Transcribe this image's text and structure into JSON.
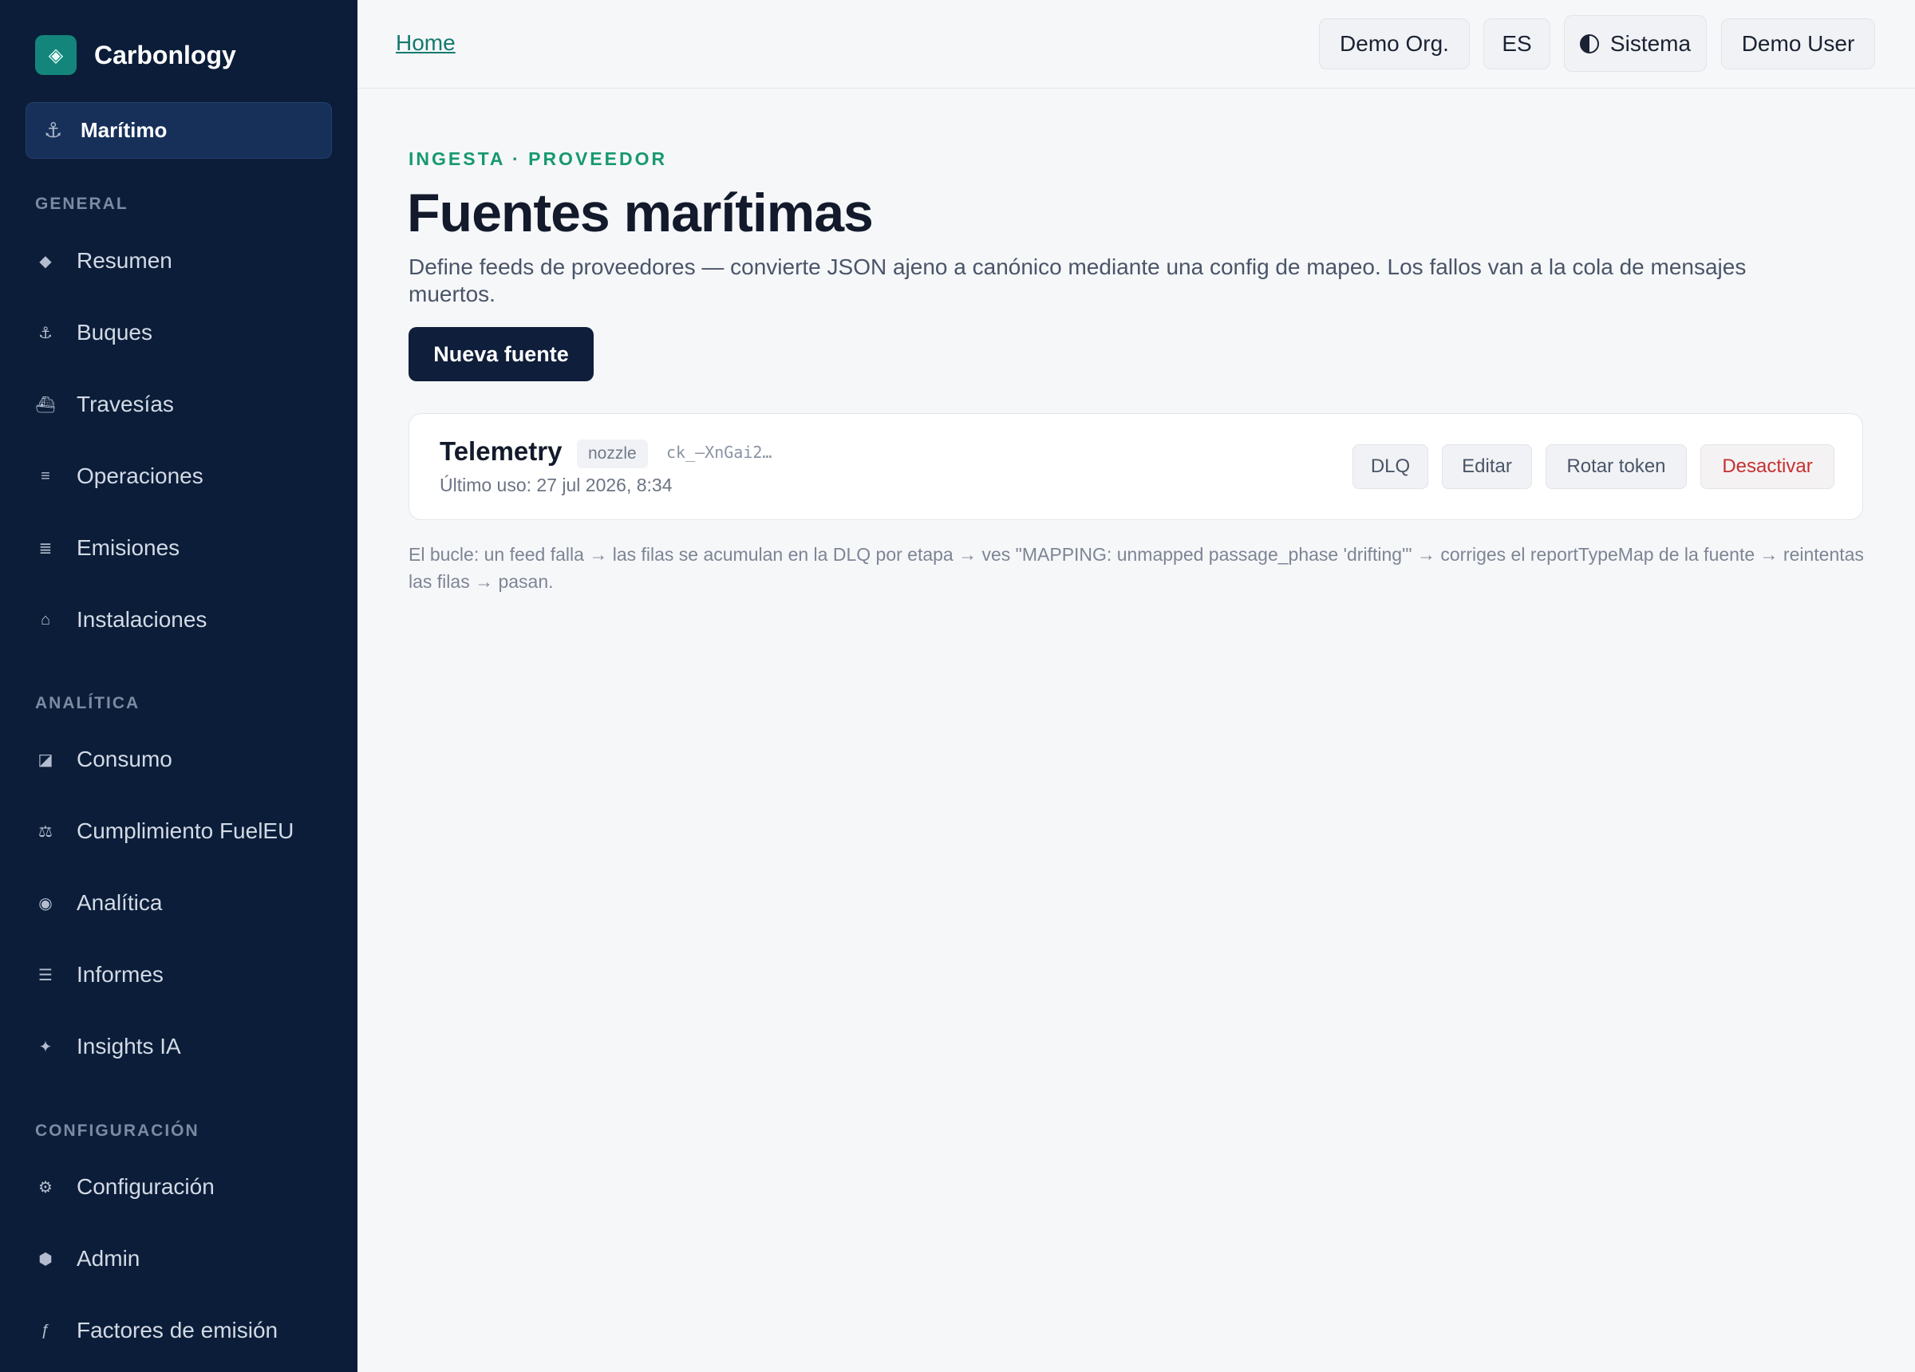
{
  "app": {
    "name": "Carbonlogy"
  },
  "module": {
    "label": "Marítimo"
  },
  "sidebar": {
    "sections": [
      {
        "title": "GENERAL",
        "items": [
          {
            "label": "Resumen",
            "icon": "diamond-icon"
          },
          {
            "label": "Buques",
            "icon": "anchor-icon"
          },
          {
            "label": "Travesías",
            "icon": "ship-icon"
          },
          {
            "label": "Operaciones",
            "icon": "list-icon"
          },
          {
            "label": "Emisiones",
            "icon": "bars-icon"
          },
          {
            "label": "Instalaciones",
            "icon": "home-icon"
          }
        ]
      },
      {
        "title": "ANALÍTICA",
        "items": [
          {
            "label": "Consumo",
            "icon": "gauge-icon"
          },
          {
            "label": "Cumplimiento FuelEU",
            "icon": "scale-icon"
          },
          {
            "label": "Analítica",
            "icon": "target-icon"
          },
          {
            "label": "Informes",
            "icon": "report-icon"
          },
          {
            "label": "Insights IA",
            "icon": "sparkle-icon"
          }
        ]
      },
      {
        "title": "CONFIGURACIÓN",
        "items": [
          {
            "label": "Configuración",
            "icon": "gear-icon"
          },
          {
            "label": "Admin",
            "icon": "hexagon-icon"
          },
          {
            "label": "Factores de emisión",
            "icon": "function-icon"
          }
        ]
      }
    ]
  },
  "header": {
    "breadcrumb": "Home",
    "org": "Demo Org.",
    "lang": "ES",
    "theme": "Sistema",
    "user": "Demo User"
  },
  "main": {
    "kicker": "INGESTA · PROVEEDOR",
    "title": "Fuentes marítimas",
    "description": "Define feeds de proveedores — convierte JSON ajeno a canónico mediante una config de mapeo. Los fallos van a la cola de mensajes muertos.",
    "new_button": "Nueva fuente",
    "sources": [
      {
        "name": "Telemetry",
        "type": "nozzle",
        "token": "ck_–XnGai2…",
        "last_used": "Último uso: 27 jul 2026, 8:34",
        "actions": {
          "dlq": "DLQ",
          "edit": "Editar",
          "rotate": "Rotar token",
          "deactivate": "Desactivar"
        }
      }
    ],
    "footnote": "El bucle: un feed falla → las filas se acumulan en la DLQ por etapa → ves \"MAPPING: unmapped passage_phase 'drifting'\" → corriges el reportTypeMap de la fuente → reintentas las filas → pasan."
  },
  "colors": {
    "sidebar_bg": "#0b1d38",
    "accent": "#17996e",
    "primary_button": "#0f1e3a",
    "danger": "#c53030"
  }
}
